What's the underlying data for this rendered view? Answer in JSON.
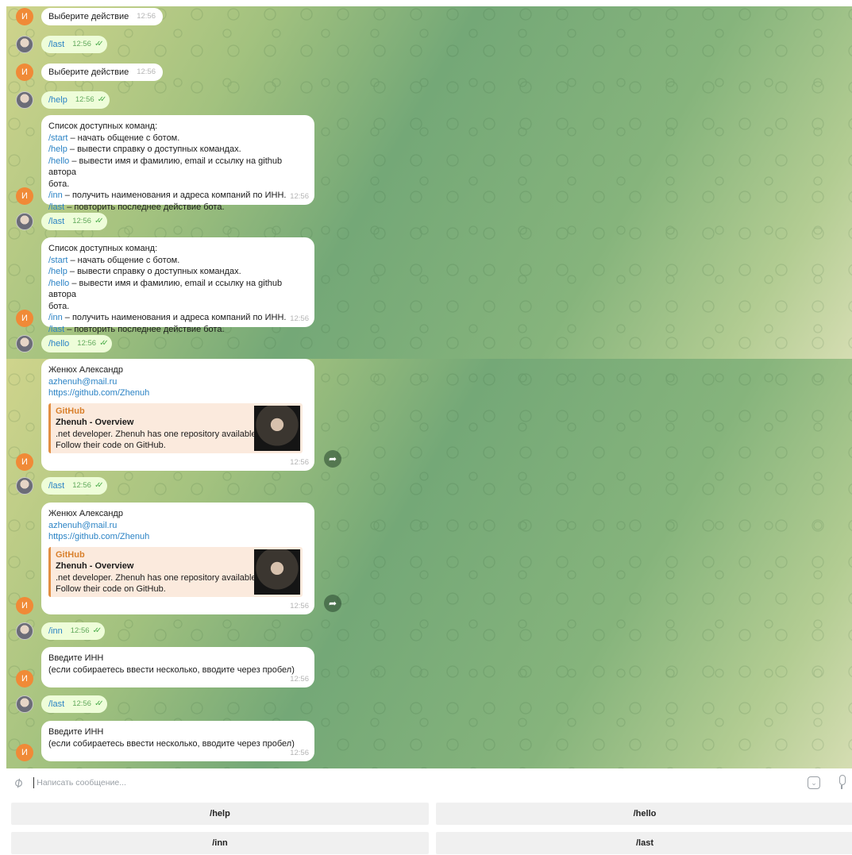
{
  "bot_avatar_letter": "И",
  "chat": {
    "bot_prompt": "Выберите действие",
    "help_text_lines": [
      {
        "cmd": "",
        "text": "Список доступных команд:"
      },
      {
        "cmd": "/start",
        "text": " – начать общение с ботом."
      },
      {
        "cmd": "/help",
        "text": " – вывести справку о доступных командах."
      },
      {
        "cmd": "/hello",
        "text": " – вывести имя и фамилию, email и ссылку на github автора"
      },
      {
        "cmd": "",
        "text": "бота."
      },
      {
        "cmd": "/inn",
        "text": " – получить наименования и адреса компаний по ИНН."
      },
      {
        "cmd": "/last",
        "text": " – повторить последнее действие бота."
      }
    ],
    "hello": {
      "name": "Женюх Александр",
      "email": "azhenuh@mail.ru",
      "github": "https://github.com/Zhenuh",
      "preview_site": "GitHub",
      "preview_title": "Zhenuh - Overview",
      "preview_desc_1": ".net developer. Zhenuh has one repository available.",
      "preview_desc_2": "Follow their code on GitHub."
    },
    "inn_prompt_1": "Введите ИНН",
    "inn_prompt_2": "(если собираетесь ввести несколько, вводите через пробел)",
    "messages": {
      "m1": {
        "text": "Выберите действие",
        "time": "12:56"
      },
      "m2": {
        "text": "/last",
        "time": "12:56"
      },
      "m3": {
        "text": "Выберите действие",
        "time": "12:56"
      },
      "m4": {
        "text": "/help",
        "time": "12:56"
      },
      "m5": {
        "time": "12:56"
      },
      "m6": {
        "text": "/last",
        "time": "12:56"
      },
      "m7": {
        "time": "12:56"
      },
      "m8": {
        "text": "/hello",
        "time": "12:56"
      },
      "m9": {
        "time": "12:56"
      },
      "m10": {
        "text": "/last",
        "time": "12:56"
      },
      "m11": {
        "time": "12:56"
      },
      "m12": {
        "text": "/inn",
        "time": "12:56"
      },
      "m13": {
        "time": "12:56"
      },
      "m14": {
        "text": "/last",
        "time": "12:56"
      },
      "m15": {
        "time": "12:56"
      }
    }
  },
  "composer": {
    "placeholder": "Написать сообщение..."
  },
  "keyboard": {
    "b1": "/help",
    "b2": "/hello",
    "b3": "/inn",
    "b4": "/last"
  },
  "icons": {
    "attach": "paperclip-icon",
    "emoji": "emoji-icon",
    "mic": "microphone-icon",
    "forward": "forward-icon",
    "read": "double-check-icon"
  }
}
